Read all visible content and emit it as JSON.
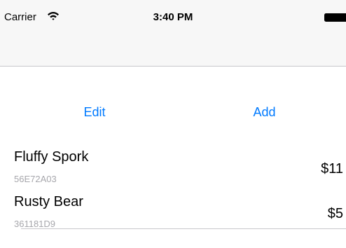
{
  "status_bar": {
    "carrier": "Carrier",
    "time": "3:40 PM",
    "icons": [
      "wifi-icon",
      "battery-icon"
    ]
  },
  "toolbar": {
    "edit_label": "Edit",
    "add_label": "Add",
    "accent_color": "#007aff"
  },
  "items": [
    {
      "name": "Fluffy Spork",
      "serial": "56E72A03",
      "price": "$11"
    },
    {
      "name": "Rusty Bear",
      "serial": "361181D9",
      "price": "$5"
    }
  ]
}
